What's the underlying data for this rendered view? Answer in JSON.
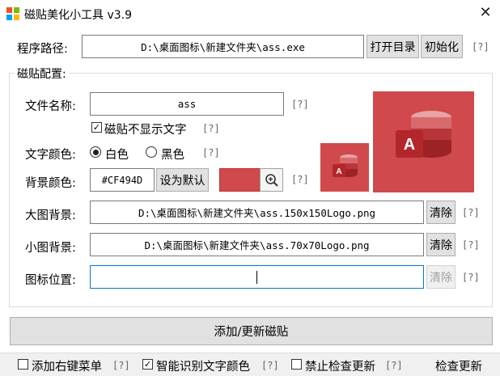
{
  "window": {
    "title": "磁贴美化小工具 v3.9",
    "close_glyph": "✕"
  },
  "path_row": {
    "label": "程序路径:",
    "value": "D:\\桌面图标\\新建文件夹\\ass.exe",
    "open_dir_button": "打开目录",
    "init_button": "初始化",
    "help": "[?]"
  },
  "group": {
    "label": "磁贴配置:"
  },
  "filename_row": {
    "label": "文件名称:",
    "value": "ass",
    "help": "[?]"
  },
  "hide_text": {
    "label": "磁贴不显示文字",
    "checked": true,
    "check_glyph": "✓",
    "help": "[?]"
  },
  "text_color": {
    "label": "文字颜色:",
    "white_label": "白色",
    "black_label": "黑色",
    "selected": "white",
    "help": "[?]"
  },
  "bg_color": {
    "label": "背景颜色:",
    "value": "#CF494D",
    "default_button": "设为默认",
    "swatch_color": "#CF494D",
    "help": "[?]"
  },
  "large_bg": {
    "label": "大图背景:",
    "value": "D:\\桌面图标\\新建文件夹\\ass.150x150Logo.png",
    "clear_button": "清除",
    "help": "[?]"
  },
  "small_bg": {
    "label": "小图背景:",
    "value": "D:\\桌面图标\\新建文件夹\\ass.70x70Logo.png",
    "clear_button": "清除",
    "help": "[?]"
  },
  "icon_pos": {
    "label": "图标位置:",
    "value": "",
    "clear_button": "清除",
    "help": "[?]"
  },
  "tile_preview": {
    "letter": "A",
    "icon": "access-icon"
  },
  "main_button": "添加/更新磁贴",
  "bottom": {
    "context_menu": {
      "label": "添加右键菜单",
      "checked": false,
      "help": "[?]"
    },
    "smart_color": {
      "label": "智能识别文字颜色",
      "checked": true,
      "help": "[?]"
    },
    "no_update": {
      "label": "禁止检查更新",
      "checked": false,
      "help": "[?]"
    },
    "check_update": "检查更新"
  }
}
